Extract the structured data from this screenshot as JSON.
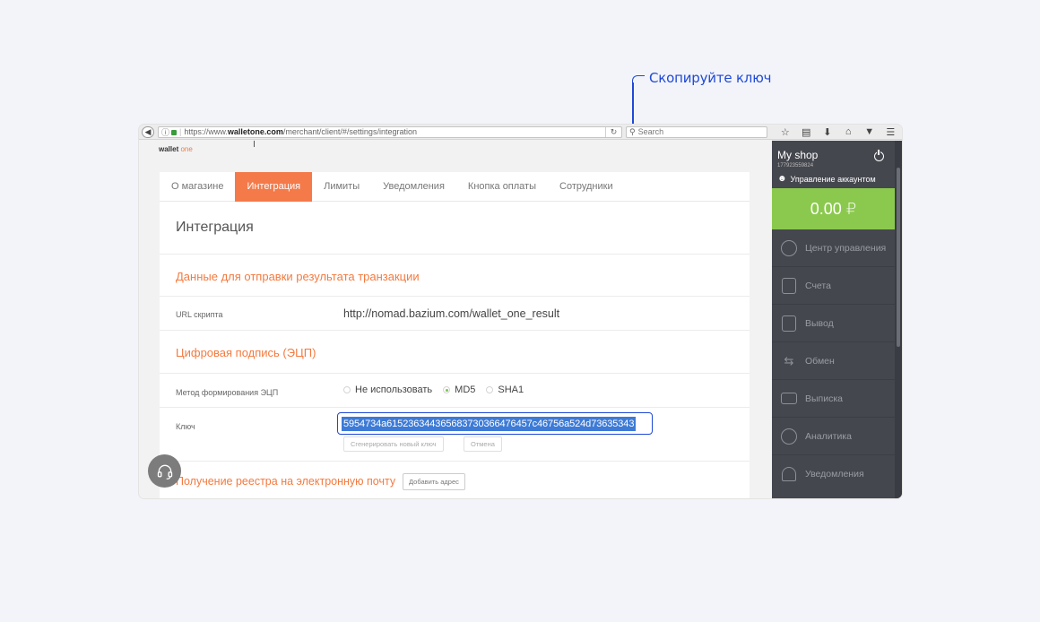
{
  "annotation": {
    "callout_text": "Скопируйте ключ",
    "color": "#1f49d6"
  },
  "browser": {
    "url_prefix": "https://www.",
    "url_domain": "walletone.com",
    "url_path": "/merchant/client/#/settings/integration",
    "search_placeholder": "Search",
    "toolbar_icons": [
      "star-icon",
      "reading-list-icon",
      "download-icon",
      "home-icon",
      "pocket-icon",
      "menu-icon"
    ]
  },
  "logo": {
    "wallet": "wallet",
    "one": "one"
  },
  "tabs": [
    {
      "label": "О магазине",
      "active": false
    },
    {
      "label": "Интеграция",
      "active": true
    },
    {
      "label": "Лимиты",
      "active": false
    },
    {
      "label": "Уведомления",
      "active": false
    },
    {
      "label": "Кнопка оплаты",
      "active": false
    },
    {
      "label": "Сотрудники",
      "active": false
    }
  ],
  "content": {
    "title": "Интеграция",
    "section_transaction": "Данные для отправки результата транзакции",
    "url_label": "URL скрипта",
    "url_value": "http://nomad.bazium.com/wallet_one_result",
    "section_signature": "Цифровая подпись (ЭЦП)",
    "method_label": "Метод формирования ЭЦП",
    "method_options": [
      {
        "label": "Не использовать",
        "checked": false
      },
      {
        "label": "MD5",
        "checked": true
      },
      {
        "label": "SHA1",
        "checked": false
      }
    ],
    "key_label": "Ключ",
    "key_value": "5954734a6152363443656837303664764​57c46756a524d73635343",
    "generate_button": "Сгенерировать новый ключ",
    "cancel_button": "Отмена",
    "registry_label": "Получение реестра на электронную почту",
    "add_address_button": "Добавить адрес"
  },
  "sidebar": {
    "shop_name": "My shop",
    "shop_id": "177923559824",
    "account_label": "Управление аккаунтом",
    "balance": "0.00 ₽",
    "accent_color": "#8bc94e",
    "menu": [
      {
        "label": "Центр управления",
        "icon": "speedometer-icon"
      },
      {
        "label": "Счета",
        "icon": "invoice-icon"
      },
      {
        "label": "Вывод",
        "icon": "withdraw-icon"
      },
      {
        "label": "Обмен",
        "icon": "exchange-icon"
      },
      {
        "label": "Выписка",
        "icon": "statement-icon"
      },
      {
        "label": "Аналитика",
        "icon": "analytics-icon"
      },
      {
        "label": "Уведомления",
        "icon": "bell-icon"
      }
    ]
  }
}
